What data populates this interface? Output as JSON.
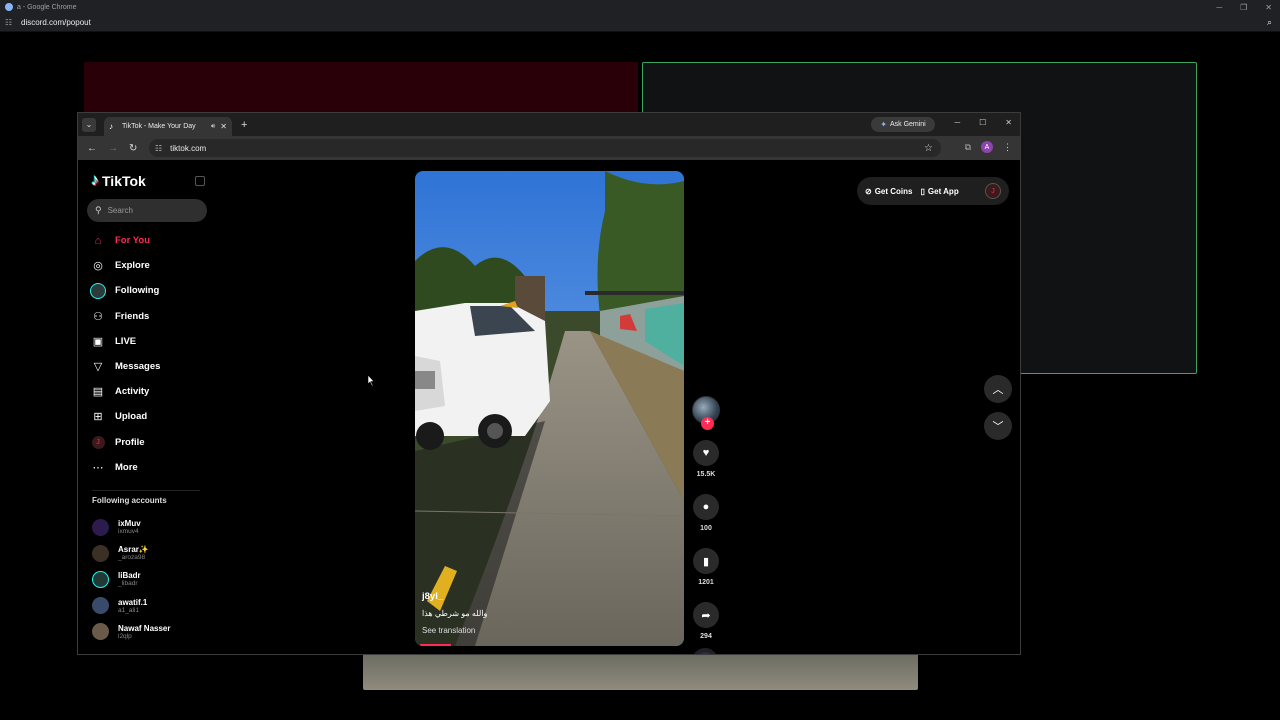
{
  "outer_window": {
    "title": "a - Google Chrome",
    "url": "discord.com/popout"
  },
  "inner_window": {
    "tab_title": "TikTok - Make Your Day",
    "ask_gemini": "Ask Gemini",
    "url": "tiktok.com",
    "profile_initial": "A"
  },
  "sidebar": {
    "logo": "TikTok",
    "search_placeholder": "Search",
    "nav": [
      {
        "label": "For You",
        "icon": "home-icon"
      },
      {
        "label": "Explore",
        "icon": "compass-icon"
      },
      {
        "label": "Following",
        "icon": "following-avatar-icon"
      },
      {
        "label": "Friends",
        "icon": "friends-icon"
      },
      {
        "label": "LIVE",
        "icon": "live-tv-icon"
      },
      {
        "label": "Messages",
        "icon": "messages-icon"
      },
      {
        "label": "Activity",
        "icon": "activity-icon"
      },
      {
        "label": "Upload",
        "icon": "upload-icon"
      },
      {
        "label": "Profile",
        "icon": "profile-icon"
      },
      {
        "label": "More",
        "icon": "more-dots-icon"
      }
    ],
    "following_heading": "Following accounts",
    "accounts": [
      {
        "name": "ixMuv",
        "handle": "ixmuv4",
        "color": "#2d1b4e"
      },
      {
        "name": "Asrar✨",
        "handle": "_aroza98",
        "color": "#3b3026"
      },
      {
        "name": "liBadr",
        "handle": "_libadr",
        "color": "#1f3a35"
      },
      {
        "name": "awatif.1",
        "handle": "a1_ali1",
        "color": "#3a4a6a"
      },
      {
        "name": "Nawaf Nasser",
        "handle": "l2qlp",
        "color": "#6a5a4a"
      }
    ]
  },
  "video": {
    "username": "j8yl_",
    "caption": "والله مو شرطي هذا",
    "see_translation": "See translation",
    "progress": 0.12
  },
  "actions": {
    "likes": "15.5K",
    "comments": "100",
    "saves": "1201",
    "shares": "294"
  },
  "topbar": {
    "get_coins": "Get Coins",
    "get_app": "Get App"
  },
  "colors": {
    "accent": "#fe2c55",
    "discord_green": "#3ba55d"
  }
}
